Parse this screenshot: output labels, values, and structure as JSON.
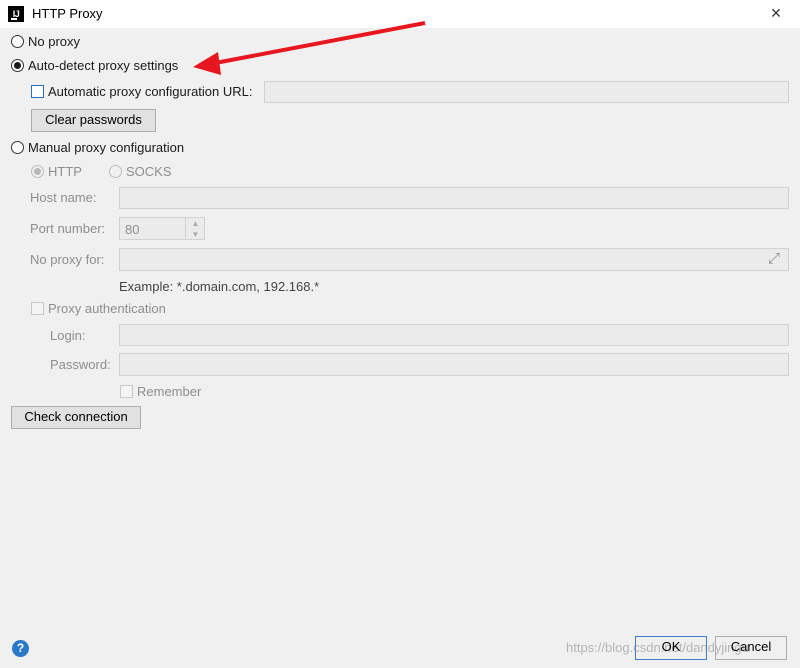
{
  "window": {
    "title": "HTTP Proxy",
    "app_icon_text": "IJ"
  },
  "proxy_mode": {
    "no_proxy": "No proxy",
    "auto_detect": "Auto-detect proxy settings",
    "manual": "Manual proxy configuration",
    "selected": "auto_detect"
  },
  "auto": {
    "pac_url_label": "Automatic proxy configuration URL:",
    "pac_url_value": "",
    "clear_passwords": "Clear passwords"
  },
  "manual": {
    "http_label": "HTTP",
    "socks_label": "SOCKS",
    "host_label": "Host name:",
    "host_value": "",
    "port_label": "Port number:",
    "port_value": "80",
    "no_proxy_label": "No proxy for:",
    "no_proxy_value": "",
    "example": "Example: *.domain.com, 192.168.*",
    "proxy_auth": "Proxy authentication",
    "login_label": "Login:",
    "password_label": "Password:",
    "remember": "Remember"
  },
  "buttons": {
    "check_connection": "Check connection",
    "ok": "OK",
    "cancel": "Cancel"
  },
  "watermark": "https://blog.csdn.net/dandyjingu",
  "colors": {
    "accent": "#2a78c8",
    "annotation_arrow": "#e8161e"
  },
  "icons": {
    "close": "×",
    "help": "?",
    "expand": "⤢",
    "spin_up": "▲",
    "spin_down": "▼"
  }
}
